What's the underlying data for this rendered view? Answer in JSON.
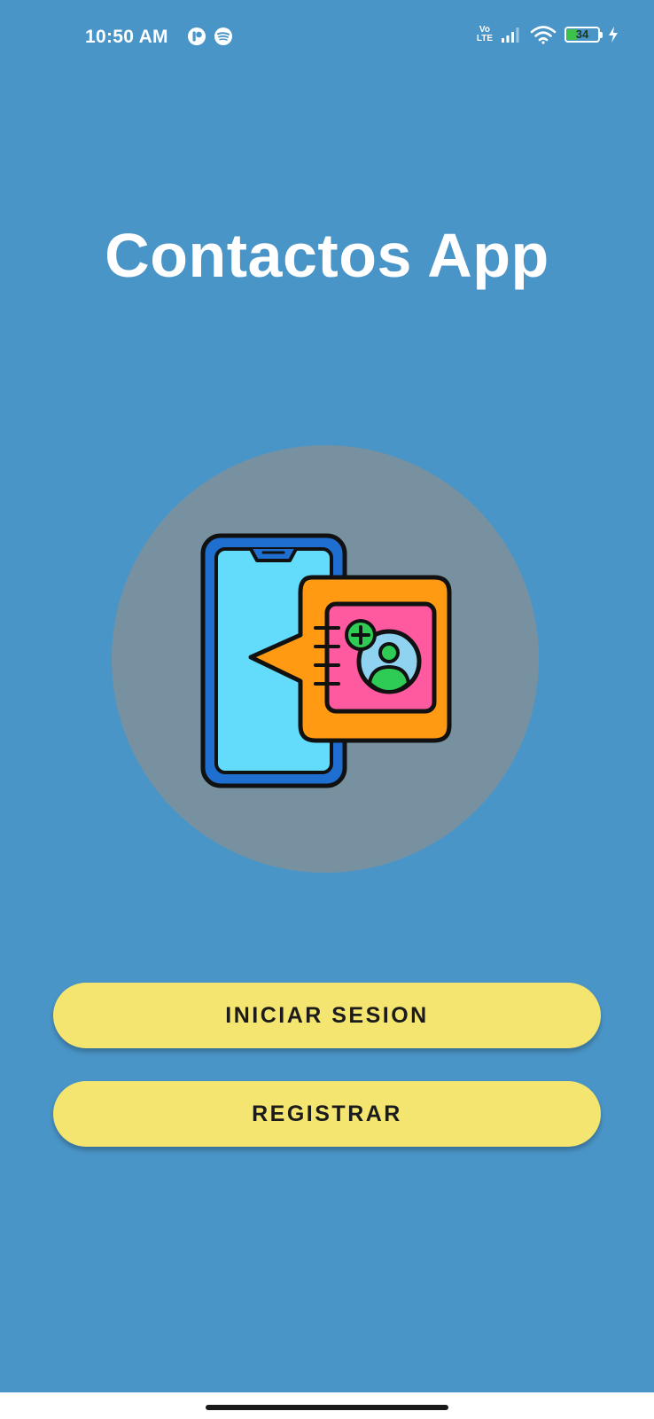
{
  "status_bar": {
    "time": "10:50 AM",
    "left_icons": [
      "notification-app-icon",
      "spotify-icon"
    ],
    "network_label_top": "Vo",
    "network_label_bottom": "LTE",
    "battery_level": "34",
    "battery_fraction": 0.34,
    "icons": [
      "signal-icon",
      "wifi-icon",
      "battery-icon",
      "charging-icon"
    ]
  },
  "app": {
    "title": "Contactos App"
  },
  "hero": {
    "icon": "phone-contact-book-icon",
    "colors": {
      "circle": "#7891a0",
      "phone_frame": "#1e6fd0",
      "phone_screen": "#62dcfa",
      "bubble": "#ff9a12",
      "card": "#ff5aa0",
      "avatar_bg": "#8fd3f0",
      "avatar_person": "#2ecc55",
      "plus_badge": "#2ecc55"
    }
  },
  "actions": {
    "login_label": "INICIAR SESION",
    "register_label": "REGISTRAR"
  },
  "theme": {
    "background": "#4a95c8",
    "button": "#f3e56f",
    "text_on_background": "#ffffff"
  }
}
